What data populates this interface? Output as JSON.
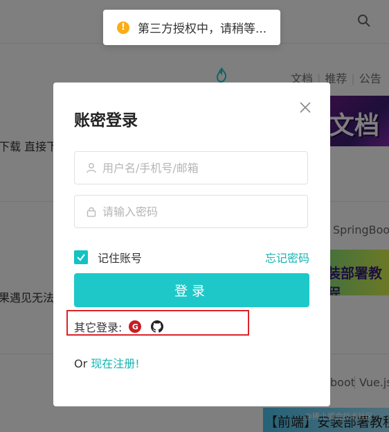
{
  "background": {
    "nav_tags": [
      "文档",
      "推荐",
      "公告"
    ],
    "left_snippets": [
      "下载 直接下",
      "果遇见无法"
    ],
    "right_snippets": [
      "SpringBoo",
      "boot",
      "Vue.js"
    ],
    "banners": [
      "文档",
      "装部署教程",
      "【前端】安装部署教程"
    ],
    "watermark": "@稀土掘金技术社区"
  },
  "toast": {
    "icon": "!",
    "text": "第三方授权中，请稍等..."
  },
  "modal": {
    "title": "账密登录",
    "username_placeholder": "用户名/手机号/邮箱",
    "password_placeholder": "请输入密码",
    "remember_label": "记住账号",
    "remember_checked": true,
    "forgot_label": "忘记密码",
    "login_label": "登录",
    "other_login_label": "其它登录:",
    "other_providers": [
      "gitee-icon",
      "github-icon"
    ],
    "gitee_glyph": "G",
    "register_prefix": "Or",
    "register_link": "现在注册!"
  },
  "colors": {
    "accent": "#1ec8c8",
    "link": "#13b3b3",
    "warning": "#faad14",
    "highlight": "#d9242b"
  }
}
